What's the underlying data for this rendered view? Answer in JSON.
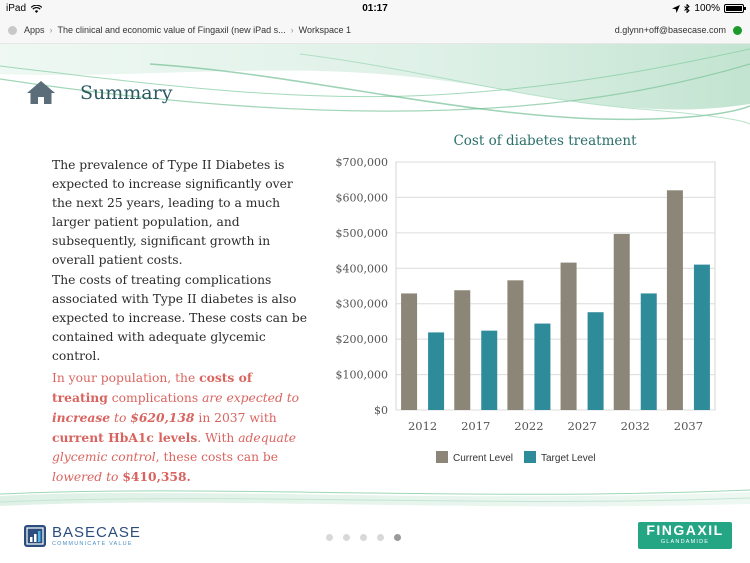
{
  "status_bar": {
    "device": "iPad",
    "time": "01:17",
    "battery": "100%"
  },
  "nav": {
    "breadcrumbs": [
      "Apps",
      "The clinical and economic value of Fingaxil (new iPad s...",
      "Workspace 1"
    ],
    "user": "d.glynn+off@basecase.com"
  },
  "page": {
    "title": "Summary",
    "para1": "The prevalence of Type II Diabetes is expected to increase significantly over the next 25 years, leading to a much larger patient population, and subsequently, significant growth in overall patient costs.",
    "para2": "The costs of treating complications associated with Type II diabetes is also expected to increase. These costs can be contained with adequate glycemic control.",
    "para3": {
      "t1": "In your population, the ",
      "b1": "costs of treating",
      "t2": " complications ",
      "i1": "are expected to ",
      "bi1": "increase",
      "i2": " to ",
      "bi2": "$620,138",
      "t3": " in 2037 with ",
      "b2": "current HbA1c levels",
      "t4": ". With ",
      "i3": "adequate glycemic control",
      "t5": ", these costs can be ",
      "i4": "lowered to",
      "t6": " ",
      "b3": "$410,358."
    }
  },
  "chart_data": {
    "type": "bar",
    "title": "Cost of diabetes treatment",
    "categories": [
      "2012",
      "2017",
      "2022",
      "2027",
      "2032",
      "2037"
    ],
    "series": [
      {
        "name": "Current Level",
        "color": "#8c8678",
        "values": [
          329000,
          338000,
          366000,
          416000,
          497000,
          620138
        ]
      },
      {
        "name": "Target Level",
        "color": "#2e8b99",
        "values": [
          219000,
          224000,
          244000,
          276000,
          329000,
          410358
        ]
      }
    ],
    "ylim": [
      0,
      700000
    ],
    "yticks": [
      "$0",
      "$100,000",
      "$200,000",
      "$300,000",
      "$400,000",
      "$500,000",
      "$600,000",
      "$700,000"
    ],
    "grid": true,
    "legend": "bottom"
  },
  "footer": {
    "brand": "BASECASE",
    "brand_tag": "COMMUNICATE VALUE",
    "product": "FINGAXIL",
    "product_tag": "GLANDAMIDE",
    "pages": 5,
    "active_page": 5
  }
}
